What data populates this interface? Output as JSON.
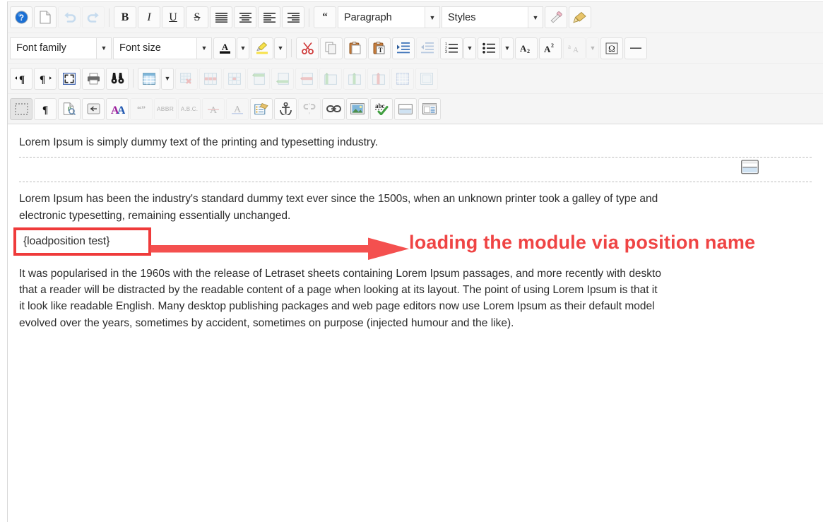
{
  "editor": {
    "name": "tinymce-wysiwyg-editor",
    "toolbar_rows": [
      {
        "id": "row1",
        "items": [
          {
            "type": "button",
            "name": "help-icon",
            "label": "?",
            "title": "Help"
          },
          {
            "type": "button",
            "name": "new-document-icon",
            "label": "",
            "title": "New document"
          },
          {
            "type": "button",
            "name": "undo-icon",
            "label": "",
            "title": "Undo",
            "disabled": true
          },
          {
            "type": "button",
            "name": "redo-icon",
            "label": "",
            "title": "Redo",
            "disabled": true
          },
          {
            "type": "separator"
          },
          {
            "type": "button",
            "name": "bold-icon",
            "label": "B",
            "title": "Bold"
          },
          {
            "type": "button",
            "name": "italic-icon",
            "label": "I",
            "title": "Italic"
          },
          {
            "type": "button",
            "name": "underline-icon",
            "label": "U",
            "title": "Underline"
          },
          {
            "type": "button",
            "name": "strikethrough-icon",
            "label": "S",
            "title": "Strikethrough"
          },
          {
            "type": "button",
            "name": "align-justify-icon",
            "label": "",
            "title": "Justify"
          },
          {
            "type": "button",
            "name": "align-center-icon",
            "label": "",
            "title": "Align center"
          },
          {
            "type": "button",
            "name": "align-left-icon",
            "label": "",
            "title": "Align left"
          },
          {
            "type": "button",
            "name": "align-right-icon",
            "label": "",
            "title": "Align right"
          },
          {
            "type": "separator"
          },
          {
            "type": "button",
            "name": "blockquote-icon",
            "label": "“",
            "title": "Blockquote"
          },
          {
            "type": "select",
            "name": "paragraph-format-select",
            "value": "Paragraph"
          },
          {
            "type": "select",
            "name": "styles-select",
            "value": "Styles"
          },
          {
            "type": "button",
            "name": "remove-formatting-icon",
            "label": "",
            "title": "Remove formatting"
          },
          {
            "type": "button",
            "name": "format-painter-icon",
            "label": "",
            "title": "Format painter"
          }
        ]
      },
      {
        "id": "row2",
        "items": [
          {
            "type": "select",
            "name": "font-family-select",
            "value": "Font family"
          },
          {
            "type": "select",
            "name": "font-size-select",
            "value": "Font size"
          },
          {
            "type": "button",
            "name": "text-color-icon",
            "label": "A",
            "title": "Text color"
          },
          {
            "type": "arrow",
            "name": "text-color-dropdown-icon"
          },
          {
            "type": "button",
            "name": "highlight-color-icon",
            "label": "",
            "title": "Background color"
          },
          {
            "type": "arrow",
            "name": "highlight-color-dropdown-icon"
          },
          {
            "type": "separator"
          },
          {
            "type": "button",
            "name": "cut-icon",
            "label": "",
            "title": "Cut"
          },
          {
            "type": "button",
            "name": "copy-icon",
            "label": "",
            "title": "Copy"
          },
          {
            "type": "button",
            "name": "paste-icon",
            "label": "",
            "title": "Paste"
          },
          {
            "type": "button",
            "name": "paste-as-text-icon",
            "label": "",
            "title": "Paste as text"
          },
          {
            "type": "button",
            "name": "indent-increase-icon",
            "label": "",
            "title": "Increase indent"
          },
          {
            "type": "button",
            "name": "indent-decrease-icon",
            "label": "",
            "title": "Decrease indent",
            "disabled": true
          },
          {
            "type": "button",
            "name": "numbered-list-icon",
            "label": "",
            "title": "Numbered list"
          },
          {
            "type": "arrow",
            "name": "numbered-list-dropdown-icon"
          },
          {
            "type": "button",
            "name": "bullet-list-icon",
            "label": "",
            "title": "Bullet list"
          },
          {
            "type": "arrow",
            "name": "bullet-list-dropdown-icon"
          },
          {
            "type": "button",
            "name": "subscript-icon",
            "label": "A₂",
            "title": "Subscript"
          },
          {
            "type": "button",
            "name": "superscript-icon",
            "label": "A²",
            "title": "Superscript"
          },
          {
            "type": "button",
            "name": "text-case-icon",
            "label": "aA",
            "title": "Change case",
            "disabled": true
          },
          {
            "type": "arrow",
            "name": "text-case-dropdown-icon",
            "disabled": true
          },
          {
            "type": "button",
            "name": "special-character-icon",
            "label": "Ω",
            "title": "Special character"
          },
          {
            "type": "button",
            "name": "horizontal-rule-icon",
            "label": "—",
            "title": "Horizontal rule"
          }
        ]
      },
      {
        "id": "row3",
        "items": [
          {
            "type": "button",
            "name": "ltr-direction-icon",
            "label": "·¶",
            "title": "Left to right"
          },
          {
            "type": "button",
            "name": "rtl-direction-icon",
            "label": "¶·",
            "title": "Right to left"
          },
          {
            "type": "button",
            "name": "fullscreen-icon",
            "label": "",
            "title": "Fullscreen"
          },
          {
            "type": "button",
            "name": "print-icon",
            "label": "",
            "title": "Print"
          },
          {
            "type": "button",
            "name": "search-replace-icon",
            "label": "",
            "title": "Find and replace"
          },
          {
            "type": "separator"
          },
          {
            "type": "button",
            "name": "insert-table-icon",
            "label": "",
            "title": "Insert table"
          },
          {
            "type": "arrow",
            "name": "table-dropdown-icon"
          },
          {
            "type": "button",
            "name": "delete-table-icon",
            "label": "",
            "title": "Delete table",
            "disabled": true
          },
          {
            "type": "button",
            "name": "table-row-properties-icon",
            "label": "",
            "title": "Table row properties",
            "disabled": true
          },
          {
            "type": "button",
            "name": "table-cell-properties-icon",
            "label": "",
            "title": "Table cell properties",
            "disabled": true
          },
          {
            "type": "button",
            "name": "insert-row-before-icon",
            "label": "",
            "title": "Insert row before",
            "disabled": true
          },
          {
            "type": "button",
            "name": "insert-row-after-icon",
            "label": "",
            "title": "Insert row after",
            "disabled": true
          },
          {
            "type": "button",
            "name": "delete-row-icon",
            "label": "",
            "title": "Delete row",
            "disabled": true
          },
          {
            "type": "button",
            "name": "insert-column-before-icon",
            "label": "",
            "title": "Insert column before",
            "disabled": true
          },
          {
            "type": "button",
            "name": "insert-column-after-icon",
            "label": "",
            "title": "Insert column after",
            "disabled": true
          },
          {
            "type": "button",
            "name": "delete-column-icon",
            "label": "",
            "title": "Delete column",
            "disabled": true
          },
          {
            "type": "button",
            "name": "split-merge-cells-icon",
            "label": "",
            "title": "Merge cells",
            "disabled": true
          },
          {
            "type": "button",
            "name": "split-cell-icon",
            "label": "",
            "title": "Split cell",
            "disabled": true
          }
        ]
      },
      {
        "id": "row4",
        "items": [
          {
            "type": "button",
            "name": "show-invisible-elements-icon",
            "label": "",
            "title": "Show invisible elements",
            "active": true
          },
          {
            "type": "button",
            "name": "show-blocks-icon",
            "label": "¶",
            "title": "Show blocks"
          },
          {
            "type": "button",
            "name": "page-properties-icon",
            "label": "",
            "title": "Page properties"
          },
          {
            "type": "button",
            "name": "insert-page-break-icon",
            "label": "",
            "title": "Insert page break"
          },
          {
            "type": "button",
            "name": "font-style-icon",
            "label": "AA",
            "title": "Font style"
          },
          {
            "type": "button",
            "name": "quotation-icon",
            "label": "“”",
            "title": "Quotation",
            "disabled": true
          },
          {
            "type": "button",
            "name": "abbreviation-icon",
            "label": "ABBR",
            "title": "Abbreviation",
            "disabled": true
          },
          {
            "type": "button",
            "name": "acronym-icon",
            "label": "A.B.C.",
            "title": "Acronym",
            "disabled": true
          },
          {
            "type": "button",
            "name": "deleted-text-icon",
            "label": "A",
            "title": "Deleted text",
            "disabled": true
          },
          {
            "type": "button",
            "name": "inserted-text-icon",
            "label": "A",
            "title": "Inserted text",
            "disabled": true
          },
          {
            "type": "button",
            "name": "article-index-icon",
            "label": "",
            "title": "Article index"
          },
          {
            "type": "button",
            "name": "anchor-icon",
            "label": "",
            "title": "Insert anchor"
          },
          {
            "type": "button",
            "name": "unlink-icon",
            "label": "",
            "title": "Remove link",
            "disabled": true
          },
          {
            "type": "button",
            "name": "link-icon",
            "label": "",
            "title": "Insert link"
          },
          {
            "type": "button",
            "name": "insert-image-icon",
            "label": "",
            "title": "Insert image"
          },
          {
            "type": "button",
            "name": "spellcheck-icon",
            "label": "abc",
            "title": "Spellcheck"
          },
          {
            "type": "button",
            "name": "read-more-icon",
            "label": "",
            "title": "Read more"
          },
          {
            "type": "button",
            "name": "toggle-editor-icon",
            "label": "",
            "title": "Toggle editor"
          }
        ]
      }
    ]
  },
  "document": {
    "paragraph_1": "Lorem Ipsum is simply dummy text of the printing and typesetting industry.",
    "read_more_label": "",
    "paragraph_2_line_1": "Lorem Ipsum has been the industry's standard dummy text ever since the 1500s, when an unknown printer took a galley of type and",
    "paragraph_2_line_2": "electronic typesetting, remaining essentially unchanged.",
    "loadposition_token": "{loadposition test}",
    "paragraph_3_line_1": "It was popularised in the 1960s with the release of Letraset sheets containing Lorem Ipsum passages, and more recently with deskto",
    "paragraph_3_line_2": "that a reader will be distracted by the readable content of a page when looking at its layout. The point of using Lorem Ipsum is that it",
    "paragraph_3_line_3": "it look like readable English. Many desktop publishing packages and web page editors now use Lorem Ipsum as their default model",
    "paragraph_3_line_4": "evolved over the years, sometimes by accident, sometimes on purpose (injected humour and the like)."
  },
  "annotation": {
    "text": "loading the module via position name",
    "color": "#ef4444",
    "highlight_border_color": "#ef3b3b"
  }
}
